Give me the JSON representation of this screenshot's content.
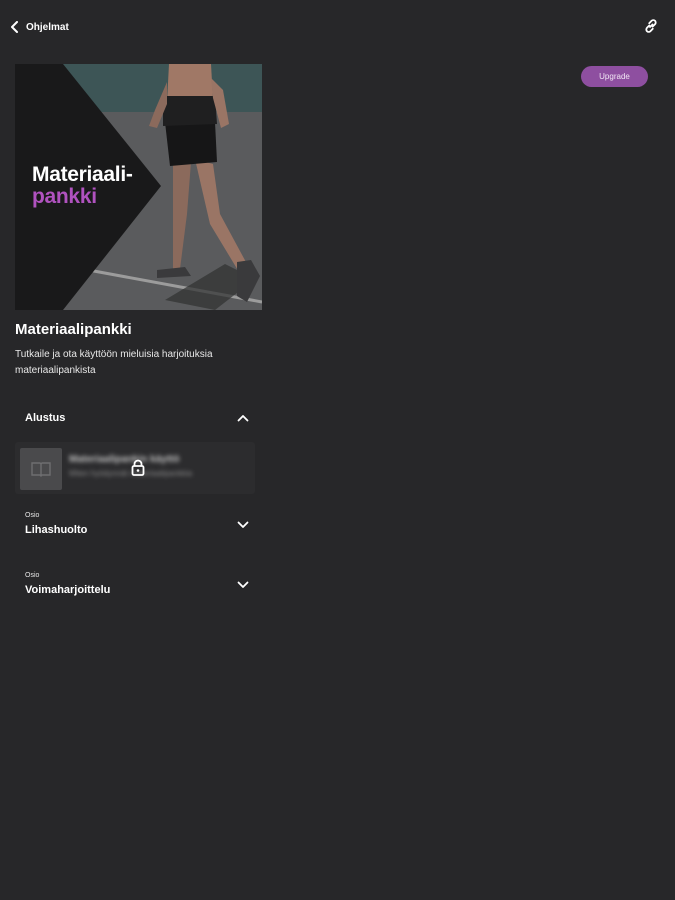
{
  "header": {
    "back_label": "Ohjelmat",
    "back_icon": "chevron-left-icon",
    "link_icon": "link-icon"
  },
  "upgrade": {
    "label": "Upgrade",
    "color": "#8e4fa0"
  },
  "cover": {
    "title_line1": "Materiaali-",
    "title_line2": "pankki",
    "accent_color": "#b052bf"
  },
  "program": {
    "title": "Materiaalipankki",
    "description": "Tutkaile ja ota käyttöön mieluisia harjoituksia materiaalipankista"
  },
  "sections": [
    {
      "label": "",
      "title": "Alustus",
      "expanded": true,
      "lessons": [
        {
          "name": "Materiaalipankin käyttö",
          "description": "Miten hyödynnät materiaalipankkia",
          "locked": true
        }
      ]
    },
    {
      "label": "Osio",
      "title": "Lihashuolto",
      "expanded": false
    },
    {
      "label": "Osio",
      "title": "Voimaharjoittelu",
      "expanded": false
    }
  ]
}
